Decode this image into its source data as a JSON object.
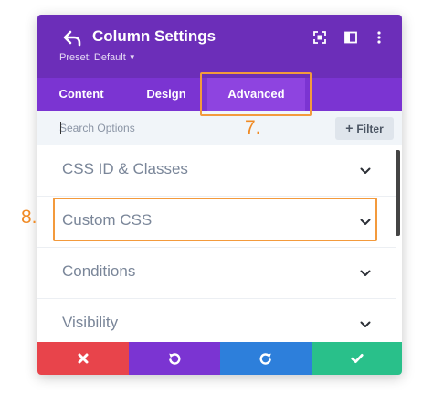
{
  "header": {
    "title": "Column Settings",
    "preset_label": "Preset: Default",
    "back_icon": "back-arrow-icon",
    "icons": [
      "expand-icon",
      "sidebar-toggle-icon",
      "more-vertical-icon"
    ],
    "bg_color": "#6c2eb9"
  },
  "tabs": [
    {
      "label": "Content",
      "active": false
    },
    {
      "label": "Design",
      "active": false
    },
    {
      "label": "Advanced",
      "active": true
    }
  ],
  "search": {
    "placeholder": "Search Options",
    "value": "",
    "filter_label": "Filter"
  },
  "sections": [
    {
      "label": "CSS ID & Classes"
    },
    {
      "label": "Custom CSS"
    },
    {
      "label": "Conditions"
    },
    {
      "label": "Visibility"
    }
  ],
  "footer": {
    "buttons": [
      {
        "name": "cancel",
        "icon": "close-x-icon",
        "color": "#e8444b"
      },
      {
        "name": "undo",
        "icon": "undo-icon",
        "color": "#7b34d2"
      },
      {
        "name": "redo",
        "icon": "redo-icon",
        "color": "#2d7fdb"
      },
      {
        "name": "save",
        "icon": "check-icon",
        "color": "#29c08a"
      }
    ]
  },
  "annotations": {
    "step7": "7.",
    "step8": "8.",
    "color": "#f39a3c"
  }
}
